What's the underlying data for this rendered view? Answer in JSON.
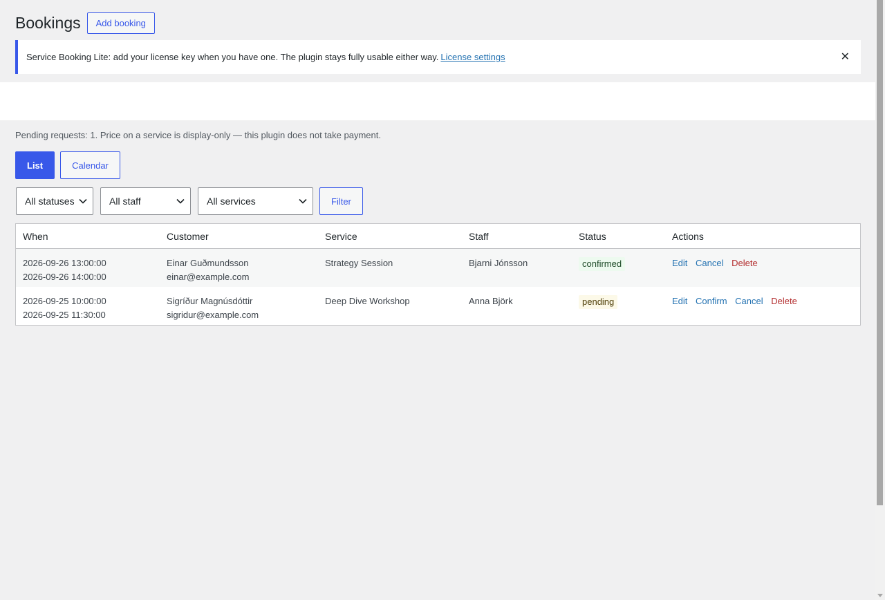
{
  "page": {
    "title": "Bookings",
    "add_button": "Add booking"
  },
  "notice": {
    "text": "Service Booking Lite: add your license key when you have one. The plugin stays fully usable either way.",
    "link": "License settings",
    "dismiss": "✕"
  },
  "summary": "Pending requests: 1. Price on a service is display-only — this plugin does not take payment.",
  "view_tabs": {
    "list": "List",
    "calendar": "Calendar"
  },
  "filters": {
    "status": "All statuses",
    "staff": "All staff",
    "service": "All services",
    "button": "Filter"
  },
  "table": {
    "headers": {
      "when": "When",
      "customer": "Customer",
      "service": "Service",
      "staff": "Staff",
      "status": "Status",
      "actions": "Actions"
    },
    "rows": [
      {
        "start": "2026-09-26 13:00:00",
        "end": "2026-09-26 14:00:00",
        "customer_name": "Einar Guðmundsson",
        "customer_email": "einar@example.com",
        "service": "Strategy Session",
        "staff": "Bjarni Jónsson",
        "status": "confirmed",
        "actions": {
          "edit": "Edit",
          "cancel": "Cancel",
          "delete": "Delete"
        }
      },
      {
        "start": "2026-09-25 10:00:00",
        "end": "2026-09-25 11:30:00",
        "customer_name": "Sigríður Magnúsdóttir",
        "customer_email": "sigridur@example.com",
        "service": "Deep Dive Workshop",
        "staff": "Anna Björk",
        "status": "pending",
        "actions": {
          "edit": "Edit",
          "confirm": "Confirm",
          "cancel": "Cancel",
          "delete": "Delete"
        }
      }
    ]
  },
  "colors": {
    "accent": "#3858e9",
    "link": "#2271b1",
    "danger": "#b32d2e",
    "background": "#f0f0f1"
  }
}
